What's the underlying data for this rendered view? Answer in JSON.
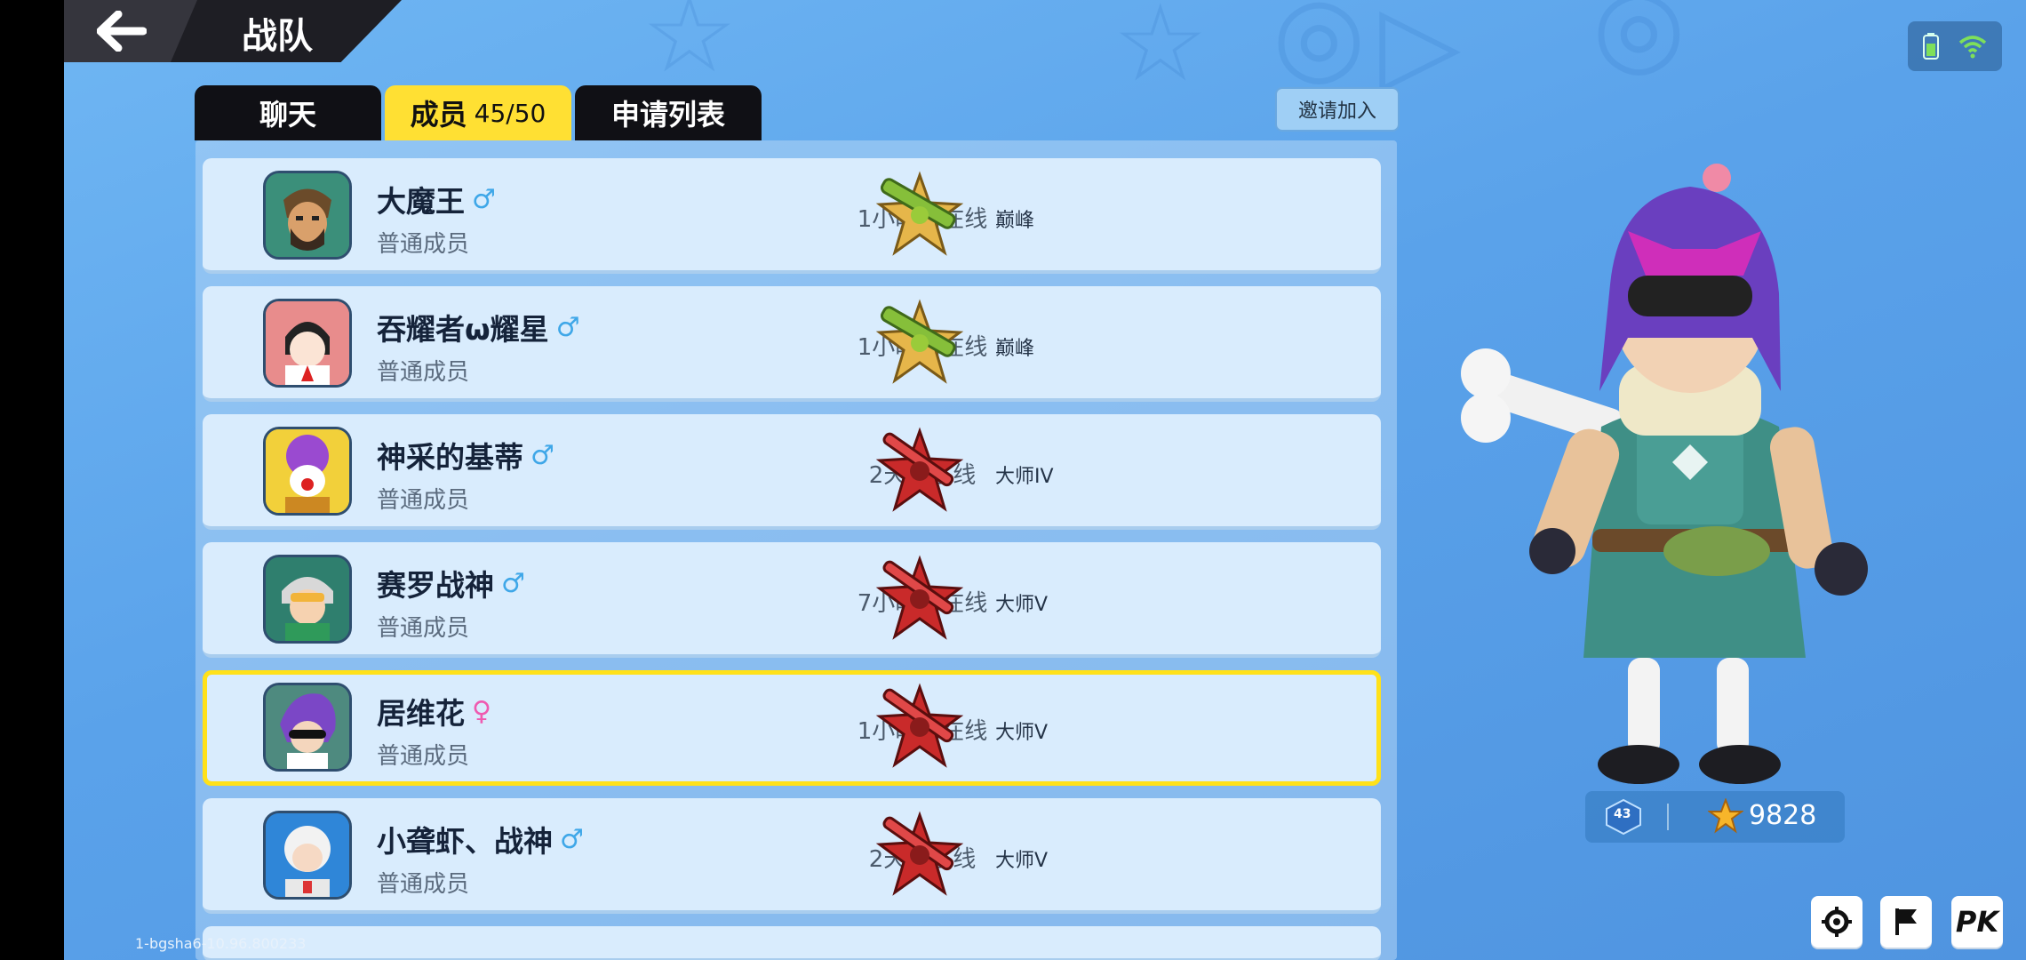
{
  "header": {
    "title": "战队"
  },
  "tabs": [
    {
      "label": "聊天"
    },
    {
      "label": "成员",
      "count": "45/50"
    },
    {
      "label": "申请列表"
    }
  ],
  "invite_label": "邀请加入",
  "members": [
    {
      "name": "大魔王",
      "gender": "♂",
      "role": "普通成员",
      "online": "1小时前在线",
      "rank": "巅峰"
    },
    {
      "name": "吞耀者ω耀星",
      "gender": "♂",
      "role": "普通成员",
      "online": "1小时前在线",
      "rank": "巅峰"
    },
    {
      "name": "神采的基蒂",
      "gender": "♂",
      "role": "普通成员",
      "online": "2天前在线",
      "rank": "大师IV"
    },
    {
      "name": "赛罗战神",
      "gender": "♂",
      "role": "普通成员",
      "online": "7小时前在线",
      "rank": "大师V"
    },
    {
      "name": "居维花",
      "gender": "♀",
      "role": "普通成员",
      "online": "1小时前在线",
      "rank": "大师V"
    },
    {
      "name": "小聋虾、战神",
      "gender": "♂",
      "role": "普通成员",
      "online": "2天前在线",
      "rank": "大师V"
    }
  ],
  "player": {
    "level": "43",
    "trophies": "9828"
  },
  "corner": {
    "pk": "PK"
  },
  "version": "1-bgsha6-10.96.800233",
  "colors": {
    "background": "#5aa2ea",
    "tab_active": "#ffe033",
    "highlight": "#ffe11a",
    "rank_peak": "#9acb3a",
    "rank_master": "#c92a2a"
  }
}
